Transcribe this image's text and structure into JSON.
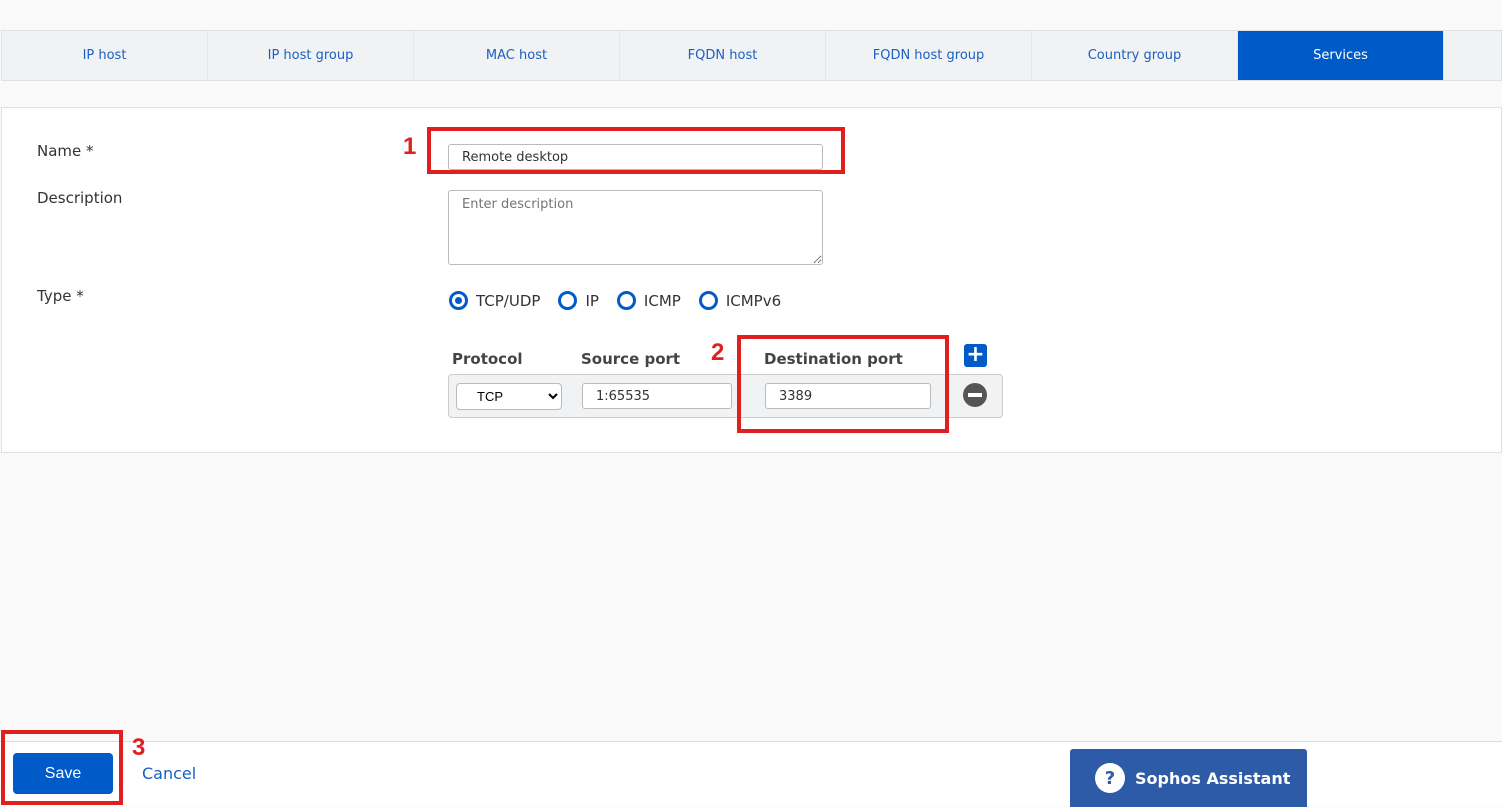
{
  "tabs": [
    {
      "label": "IP host"
    },
    {
      "label": "IP host group"
    },
    {
      "label": "MAC host"
    },
    {
      "label": "FQDN host"
    },
    {
      "label": "FQDN host group"
    },
    {
      "label": "Country group"
    },
    {
      "label": "Services",
      "active": true
    }
  ],
  "form": {
    "name_label": "Name *",
    "name_value": "Remote desktop",
    "description_label": "Description",
    "description_placeholder": "Enter description",
    "type_label": "Type *",
    "type_options": [
      "TCP/UDP",
      "IP",
      "ICMP",
      "ICMPv6"
    ],
    "type_selected": "TCP/UDP",
    "protocol_header": "Protocol",
    "source_header": "Source port",
    "destination_header": "Destination port",
    "protocol_value": "TCP",
    "source_value": "1:65535",
    "destination_value": "3389"
  },
  "annotations": [
    "1",
    "2",
    "3"
  ],
  "footer": {
    "save": "Save",
    "cancel": "Cancel",
    "assistant": "Sophos Assistant"
  },
  "colors": {
    "accent": "#005bc8",
    "annotation": "#e0201e"
  }
}
